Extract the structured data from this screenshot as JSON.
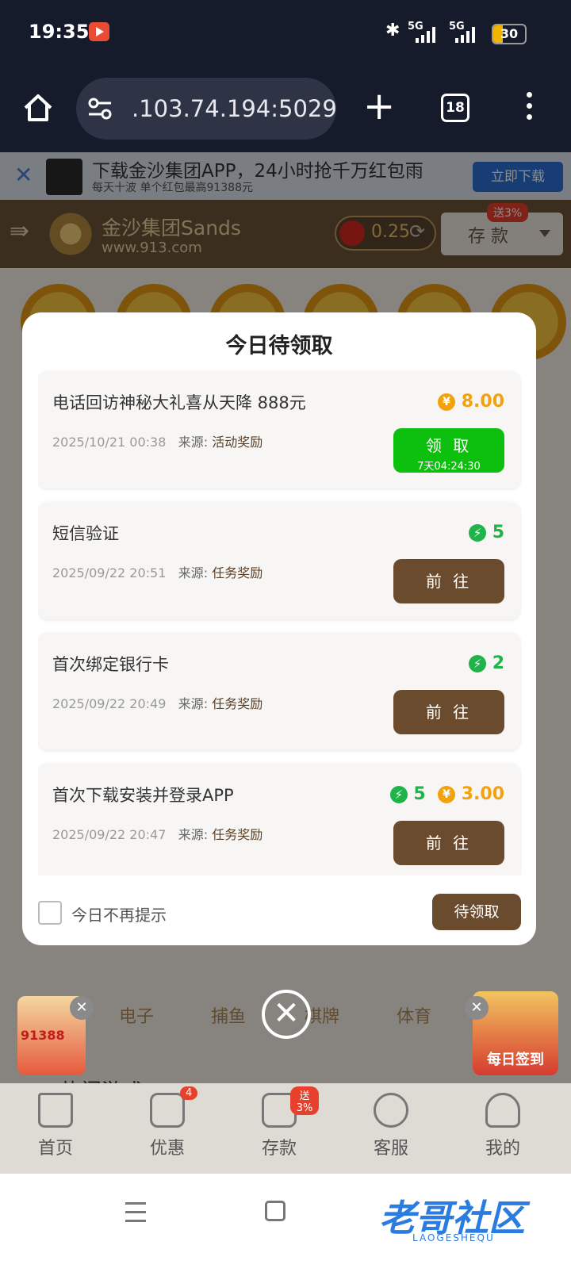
{
  "status_bar": {
    "time": "19:35",
    "battery": "30",
    "signal_1": "5G",
    "signal_2": "5G"
  },
  "browser": {
    "url": ".103.74.194:5029",
    "tab_count": "18"
  },
  "banner": {
    "title": "下载金沙集团APP，24小时抢千万红包雨",
    "subtitle": "每天十波 单个红包最高91388元",
    "download_label": "立即下载"
  },
  "header": {
    "brand_name": "金沙集团Sands",
    "brand_url": "www.913.com",
    "balance": "0.25",
    "deposit_label": "存 款",
    "deposit_badge": "送3%"
  },
  "background": {
    "categories": [
      "电子",
      "捕鱼",
      "棋牌",
      "体育"
    ],
    "hot_games_title": "热门游戏",
    "promo_left_text": "91388",
    "promo_right_text": "每日签到"
  },
  "modal": {
    "title": "今日待领取",
    "items": [
      {
        "title": "电话回访神秘大礼喜从天降 888元",
        "date": "2025/10/21 00:38",
        "source_label": "来源:",
        "source": "活动奖励",
        "reward_amount": "8.00",
        "button_label": "领 取",
        "button_timer": "7天04:24:30"
      },
      {
        "title": "短信验证",
        "date": "2025/09/22 20:51",
        "source_label": "来源:",
        "source": "任务奖励",
        "reward_points": "5",
        "button_label": "前 往"
      },
      {
        "title": "首次绑定银行卡",
        "date": "2025/09/22 20:49",
        "source_label": "来源:",
        "source": "任务奖励",
        "reward_points": "2",
        "button_label": "前 往"
      },
      {
        "title": "首次下载安装并登录APP",
        "date": "2025/09/22 20:47",
        "source_label": "来源:",
        "source": "任务奖励",
        "reward_points": "5",
        "reward_amount": "3.00",
        "button_label": "前 往"
      }
    ],
    "no_remind_label": "今日不再提示",
    "pending_button": "待领取"
  },
  "bottom_nav": {
    "items": [
      {
        "label": "首页"
      },
      {
        "label": "优惠",
        "badge": "4"
      },
      {
        "label": "存款",
        "badge": "送3%"
      },
      {
        "label": "客服"
      },
      {
        "label": "我的"
      }
    ]
  },
  "watermark": {
    "text": "老哥社区",
    "sub": "LAOGESHEQU"
  },
  "colors": {
    "accent_brown": "#6b4b2e",
    "claim_green": "#0ec00e",
    "gold": "#f2a20d",
    "points_green": "#1fb34a"
  }
}
